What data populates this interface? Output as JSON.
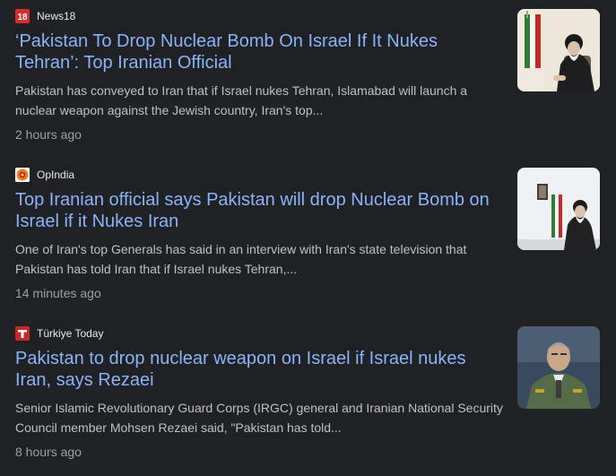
{
  "articles": [
    {
      "source": "News18",
      "source_icon": "news18-logo-icon",
      "source_color": "#d32f2f",
      "headline": "‘Pakistan To Drop Nuclear Bomb On Israel If It Nukes Tehran’: Top Iranian Official",
      "snippet": "Pakistan has conveyed to Iran that if Israel nukes Tehran, Islamabad will launch a nuclear weapon against the Jewish country, Iran's top...",
      "time": "2 hours ago",
      "thumbnail": "cleric-seated-with-flag-thumbnail"
    },
    {
      "source": "OpIndia",
      "source_icon": "opindia-logo-icon",
      "source_color": "#e8821e",
      "headline": "Top Iranian official says Pakistan will drop Nuclear Bomb on Israel if it Nukes Iran",
      "snippet": "One of Iran's top Generals has said in an interview with Iran's state television that Pakistan has told Iran that if Israel nukes Tehran,...",
      "time": "14 minutes ago",
      "thumbnail": "cleric-seated-with-portrait-thumbnail"
    },
    {
      "source": "Türkiye Today",
      "source_icon": "turkiye-today-logo-icon",
      "source_color": "#c62828",
      "headline": "Pakistan to drop nuclear weapon on Israel if Israel nukes Iran, says Rezaei",
      "snippet": "Senior Islamic Revolutionary Guard Corps (IRGC) general and Iranian National Security Council member Mohsen Rezaei said, \"Pakistan has told...",
      "time": "8 hours ago",
      "thumbnail": "general-in-uniform-thumbnail"
    }
  ]
}
